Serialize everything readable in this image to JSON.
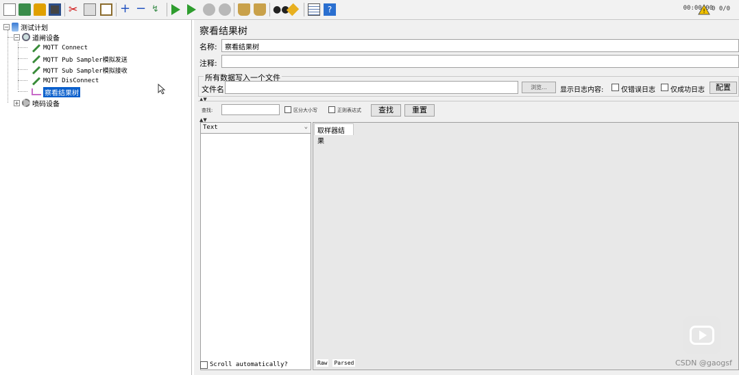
{
  "toolbar": {
    "buttons": [
      "new-icon",
      "templates-icon",
      "open-icon",
      "save-icon",
      "cut-icon",
      "copy-icon",
      "paste-icon",
      "expand-icon",
      "collapse-icon",
      "toggle-icon",
      "start-icon",
      "start-no-pause-icon",
      "stop-icon",
      "shutdown-icon",
      "clear-icon",
      "clear-all-icon",
      "search-icon",
      "reset-search-icon",
      "function-helper-icon",
      "help-icon"
    ],
    "timer": "00:00:00",
    "error_count": "0 0/0"
  },
  "tree": {
    "root": "测试计划",
    "group": "道闸设备",
    "samplers": [
      "MQTT Connect",
      "MQTT Pub Sampler模拟发送",
      "MQTT Sub Sampler模拟接收",
      "MQTT DisConnect"
    ],
    "selected": "察看结果树",
    "other_group": "喷码设备"
  },
  "panel": {
    "title": "察看结果树",
    "name_label": "名称:",
    "name_value": "察看结果树",
    "comment_label": "注释:",
    "file_group_title": "所有数据写入一个文件",
    "filename_label": "文件名",
    "browse_button": "浏览...",
    "log_content_label": "显示日志内容:",
    "errors_only_label": "仅错误日志",
    "success_only_label": "仅成功日志",
    "configure_button": "配置",
    "search_label": "查找:",
    "case_sensitive_label": "区分大小写",
    "regex_label": "正则表达式",
    "find_button": "查找",
    "reset_button": "重置",
    "renderer_value": "Text",
    "scroll_auto_label": "Scroll automatically?",
    "result_tab": "取样器结果",
    "bottom_tabs": [
      "Raw",
      "Parsed"
    ]
  },
  "watermark": "CSDN @gaogsf"
}
